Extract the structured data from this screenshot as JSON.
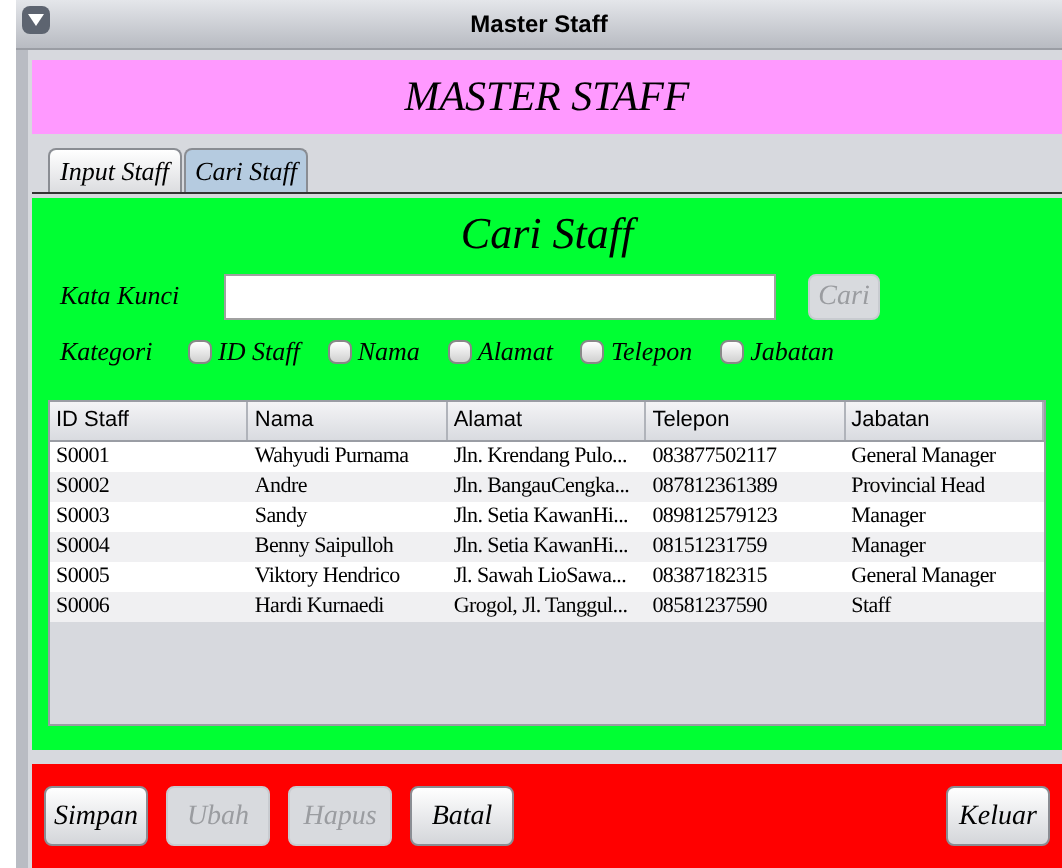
{
  "window": {
    "title": "Master Staff"
  },
  "banner": {
    "title": "MASTER STAFF"
  },
  "tabs": [
    {
      "label": "Input Staff",
      "selected": false
    },
    {
      "label": "Cari Staff",
      "selected": true
    }
  ],
  "search_panel": {
    "title": "Cari Staff",
    "keyword_label": "Kata Kunci",
    "search_button": {
      "label": "Cari",
      "disabled": true
    },
    "category_label": "Kategori",
    "categories": [
      {
        "label": "ID Staff",
        "checked": false
      },
      {
        "label": "Nama",
        "checked": false
      },
      {
        "label": "Alamat",
        "checked": false
      },
      {
        "label": "Telepon",
        "checked": false
      },
      {
        "label": "Jabatan",
        "checked": false
      }
    ]
  },
  "table": {
    "columns": [
      "ID Staff",
      "Nama",
      "Alamat",
      "Telepon",
      "Jabatan"
    ],
    "rows": [
      [
        "S0001",
        "Wahyudi Purnama",
        "Jln. Krendang Pulo...",
        "083877502117",
        "General Manager"
      ],
      [
        "S0002",
        "Andre",
        "Jln. BangauCengka...",
        "087812361389",
        "Provincial Head"
      ],
      [
        "S0003",
        "Sandy",
        "Jln. Setia KawanHi...",
        "089812579123",
        "Manager"
      ],
      [
        "S0004",
        "Benny Saipulloh",
        "Jln. Setia KawanHi...",
        "08151231759",
        "Manager"
      ],
      [
        "S0005",
        "Viktory Hendrico",
        "Jl. Sawah LioSawa...",
        "08387182315",
        "General Manager"
      ],
      [
        "S0006",
        "Hardi Kurnaedi",
        "Grogol, Jl. Tanggul...",
        "08581237590",
        "Staff"
      ]
    ]
  },
  "buttons": [
    {
      "label": "Simpan",
      "disabled": false,
      "kind": "left"
    },
    {
      "label": "Ubah",
      "disabled": true,
      "kind": "left"
    },
    {
      "label": "Hapus",
      "disabled": true,
      "kind": "left"
    },
    {
      "label": "Batal",
      "disabled": false,
      "kind": "left"
    },
    {
      "label": "Keluar",
      "disabled": false,
      "kind": "right"
    }
  ]
}
